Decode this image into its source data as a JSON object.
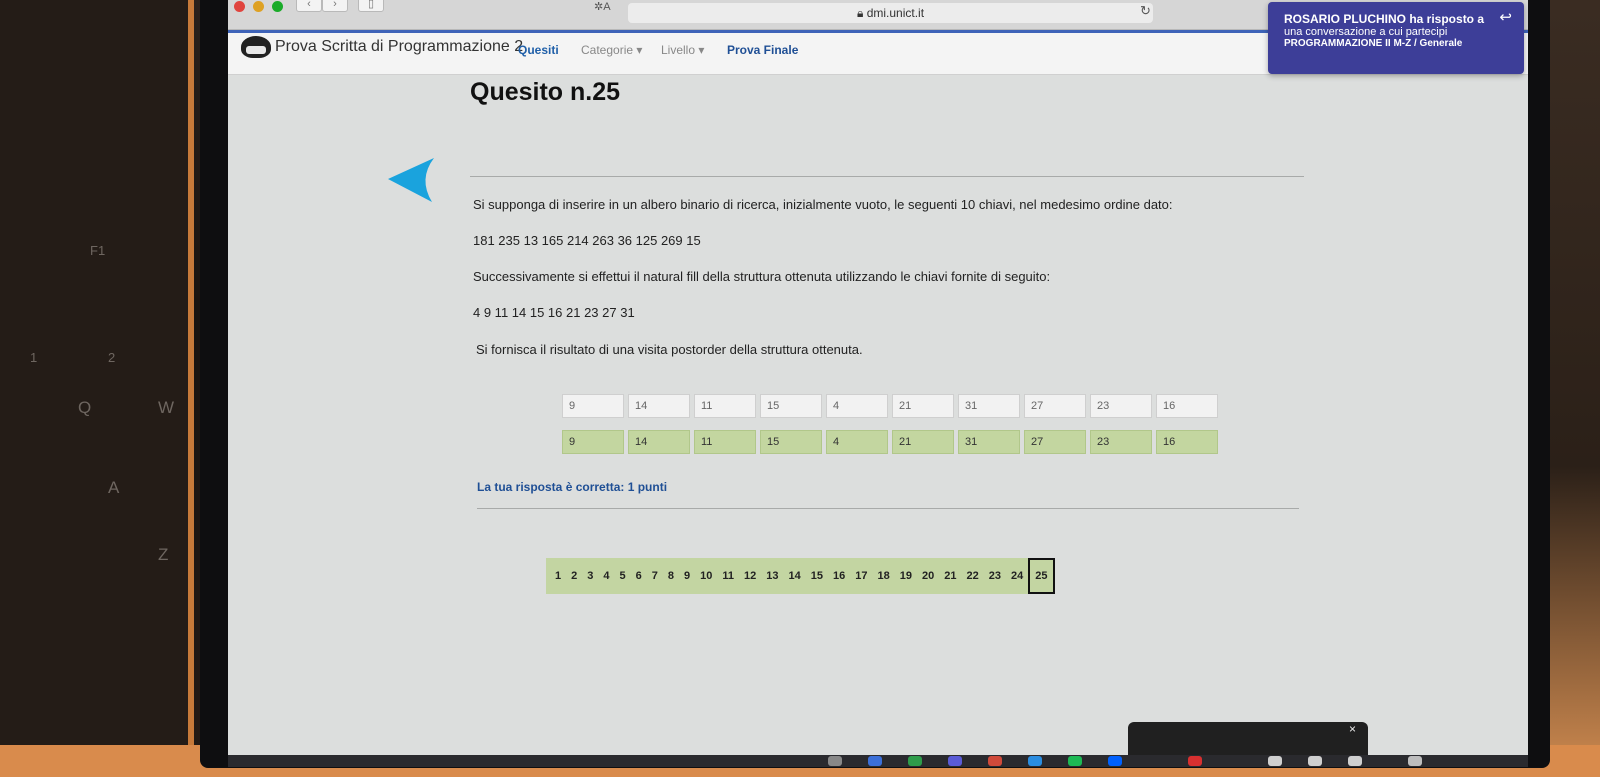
{
  "browser": {
    "url": "dmi.unict.it",
    "translate_icon": "aA-icon",
    "lock_icon": "lock-icon",
    "reload_icon": "reload-icon"
  },
  "nav": {
    "app_title": "Prova Scritta di Programmazione 2",
    "links": [
      {
        "label": "Quesiti",
        "active": true
      },
      {
        "label": "Categorie ▾",
        "active": false
      },
      {
        "label": "Livello ▾",
        "active": false
      },
      {
        "label": "Prova Finale",
        "active": false
      }
    ]
  },
  "notification": {
    "title": "ROSARIO PLUCHINO ha risposto a",
    "text": "una conversazione a cui partecipi",
    "group": "PROGRAMMAZIONE II M-Z / Generale"
  },
  "question": {
    "title": "Quesito n.25",
    "intro": "Si supponga di inserire in un albero binario di ricerca, inizialmente vuoto, le seguenti 10 chiavi, nel medesimo ordine dato:",
    "keys": "181 235 13 165 214 263 36 125 269 15",
    "instruction": "Successivamente si effettui il natural fill della struttura ottenuta utilizzando le chiavi fornite di seguito:",
    "fill_keys": "4 9 11 14 15 16 21 23 27 31",
    "prompt": "Si fornisca il risultato di una visita postorder della struttura ottenuta."
  },
  "answer_inputs": [
    "9",
    "14",
    "11",
    "15",
    "4",
    "21",
    "31",
    "27",
    "23",
    "16"
  ],
  "correct_answers": [
    "9",
    "14",
    "11",
    "15",
    "4",
    "21",
    "31",
    "27",
    "23",
    "16"
  ],
  "result_text": "La tua risposta è corretta: 1 punti",
  "pagination": {
    "pages": [
      "1",
      "2",
      "3",
      "4",
      "5",
      "6",
      "7",
      "8",
      "9",
      "10",
      "11",
      "12",
      "13",
      "14",
      "15",
      "16",
      "17",
      "18",
      "19",
      "20",
      "21",
      "22",
      "23",
      "24",
      "25"
    ],
    "current": "25"
  },
  "taskbar": {
    "close_label": "×"
  },
  "colors": {
    "nav_accent": "#1f5fa8",
    "notification_bg": "#3d3e98",
    "correct_green": "#c3d6a0",
    "back_arrow": "#1aa3dd"
  }
}
